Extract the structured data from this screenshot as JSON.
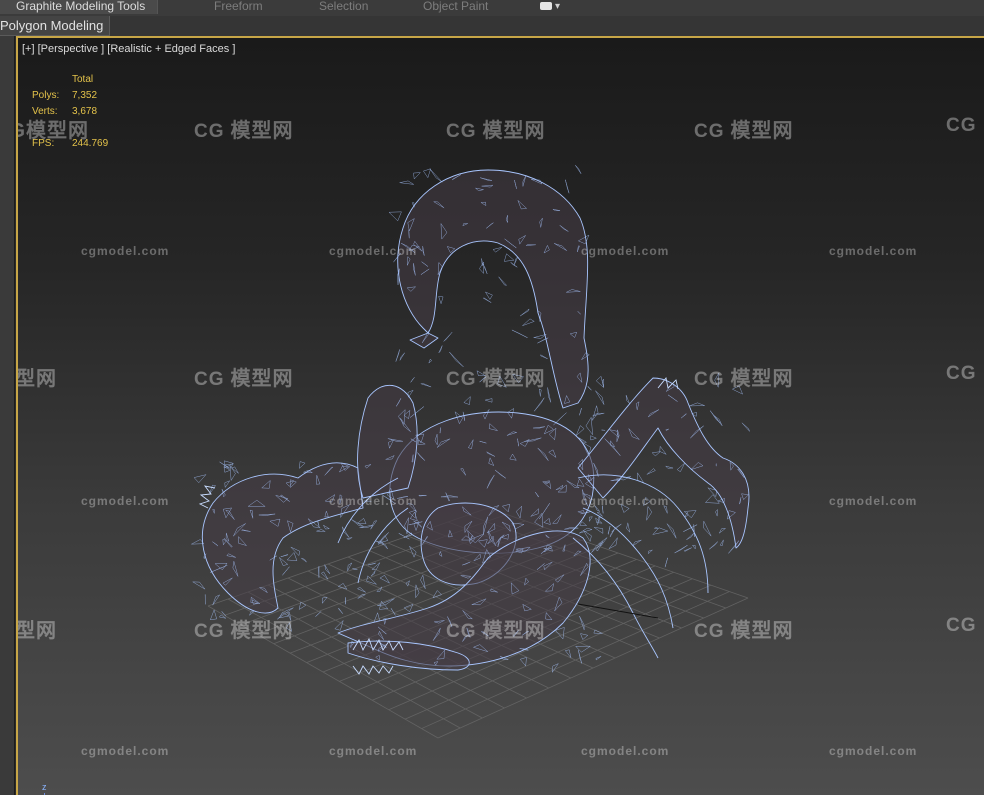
{
  "ribbon": {
    "tabs": [
      "Graphite Modeling Tools",
      "Freeform",
      "Selection",
      "Object Paint"
    ],
    "active_tab": "Graphite Modeling Tools"
  },
  "subpanel": {
    "label": "Polygon Modeling"
  },
  "viewport": {
    "label": "[+] [Perspective ] [Realistic + Edged Faces ]",
    "border_color": "#c7a647",
    "stats": {
      "header": "Total",
      "polys_label": "Polys:",
      "polys_value": "7,352",
      "verts_label": "Verts:",
      "verts_value": "3,678",
      "fps_label": "FPS:",
      "fps_value": "244.769"
    },
    "axis_label": "z"
  },
  "watermarks": {
    "text": "cgmodel.com",
    "logo_text": "模型网",
    "logo_glyph": "CG"
  },
  "colors": {
    "wire": "#a9c6ff",
    "stats": "#e3c24a",
    "grid": "#6a6a6a"
  }
}
